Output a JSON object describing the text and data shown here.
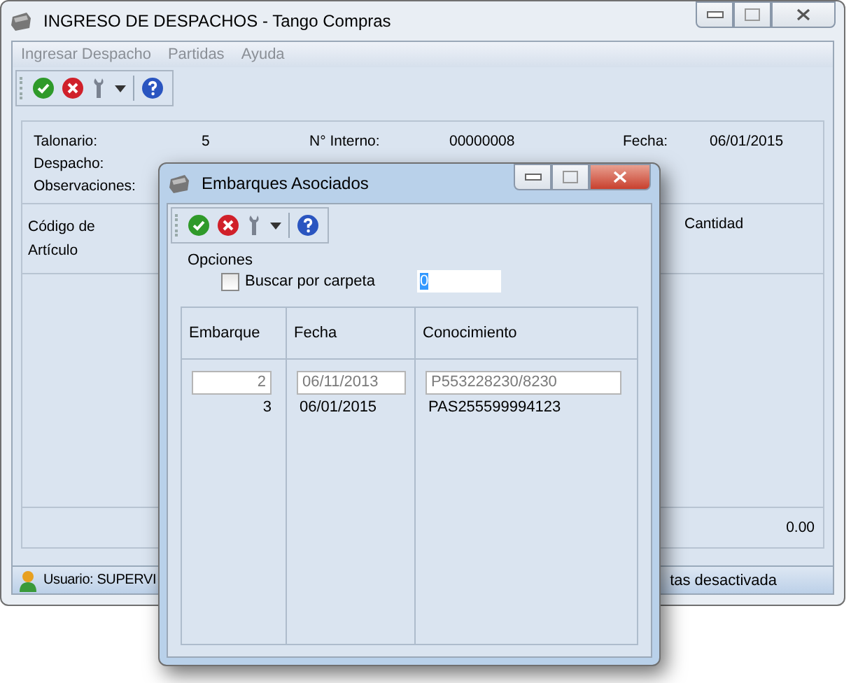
{
  "main_window": {
    "title": "INGRESO DE DESPACHOS - Tango Compras",
    "menu": [
      "Ingresar Despacho",
      "Partidas",
      "Ayuda"
    ],
    "header_fields": [
      {
        "label": "Talonario:",
        "value": "5"
      },
      {
        "label": "N° Interno:",
        "value": "00000008"
      },
      {
        "label": "Fecha:",
        "value": "06/01/2015"
      }
    ],
    "extra_labels": [
      "Despacho:",
      "Observaciones:"
    ],
    "grid_columns": [
      "Código de Artículo",
      "Cantidad"
    ],
    "total": "0.00",
    "status": [
      "Usuario: SUPERVI",
      "tas desactivada"
    ]
  },
  "dialog": {
    "title": "Embarques Asociados",
    "options_label": "Opciones",
    "checkbox": {
      "label": "Buscar por carpeta",
      "checked": false
    },
    "folder_field": {
      "value": "0"
    },
    "columns": [
      "Embarque",
      "Fecha",
      "Conocimiento"
    ],
    "rows": [
      {
        "kind": "field",
        "embarque": "2",
        "fecha": "06/11/2013",
        "conocimiento": "P553228230/8230"
      },
      {
        "kind": "text",
        "embarque": "3",
        "fecha": "06/01/2015",
        "conocimiento": "PAS255599994123"
      }
    ]
  }
}
